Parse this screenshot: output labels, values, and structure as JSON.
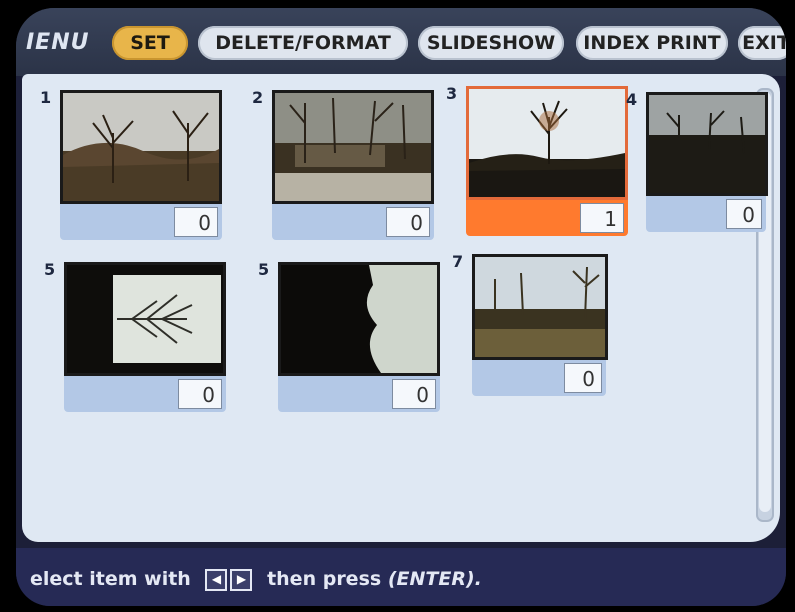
{
  "menu": {
    "label": "IENU",
    "tabs": [
      {
        "label": "SET",
        "active": true
      },
      {
        "label": "DELETE/FORMAT",
        "active": false
      },
      {
        "label": "SLIDESHOW",
        "active": false
      },
      {
        "label": "INDEX PRINT",
        "active": false
      },
      {
        "label": "EXIT",
        "active": false
      }
    ]
  },
  "thumbnails": [
    {
      "number": "1",
      "count": "0",
      "selected": false
    },
    {
      "number": "2",
      "count": "0",
      "selected": false
    },
    {
      "number": "3",
      "count": "1",
      "selected": true
    },
    {
      "number": "4",
      "count": "0",
      "selected": false
    },
    {
      "number": "5",
      "count": "0",
      "selected": false
    },
    {
      "number": "5",
      "count": "0",
      "selected": false
    },
    {
      "number": "7",
      "count": "0",
      "selected": false
    }
  ],
  "hint": {
    "prefix": "elect item with",
    "suffix": "then press",
    "key": "(ENTER)."
  },
  "icons": {
    "left": "arrow-left-icon",
    "right": "arrow-right-icon"
  },
  "colors": {
    "active_tab": "#e8b54a",
    "selected_bar": "#ff7a2e",
    "panel_bg": "#dfe8f3"
  }
}
